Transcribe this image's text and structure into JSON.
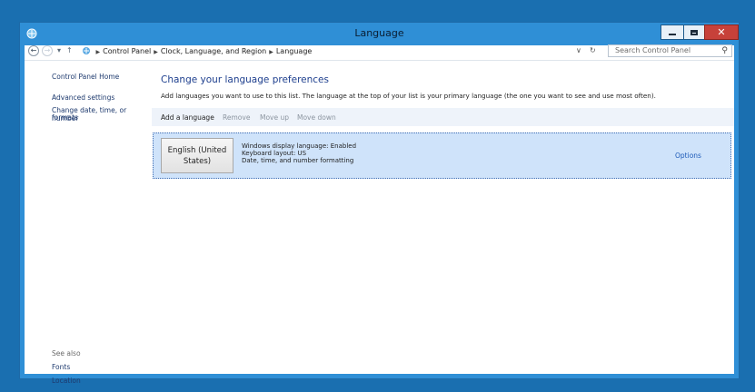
{
  "window": {
    "title": "Language"
  },
  "address": {
    "crumbs": [
      "Control Panel",
      "Clock, Language, and Region",
      "Language"
    ],
    "search_placeholder": "Search Control Panel"
  },
  "left_pane": {
    "home": "Control Panel Home",
    "advanced": "Advanced settings",
    "change_formats_line1": "Change date, time, or number",
    "change_formats_line2": "formats",
    "see_also": "See also",
    "fonts": "Fonts",
    "location": "Location"
  },
  "main": {
    "heading": "Change your language preferences",
    "description": "Add languages you want to use to this list. The language at the top of your list is your primary language (the one you want to see and use most often).",
    "toolbar": {
      "add": "Add a language",
      "remove": "Remove",
      "move_up": "Move up",
      "move_down": "Move down"
    },
    "languages": [
      {
        "name_line1": "English (United",
        "name_line2": "States)",
        "details": [
          "Windows display language: Enabled",
          "Keyboard layout: US",
          "Date, time, and number formatting"
        ],
        "options": "Options"
      }
    ]
  },
  "colors": {
    "desktop": "#1a6fb0",
    "window_frame": "#2f8fd6",
    "close_button": "#c7413a",
    "selected_row": "#cfe3fa",
    "link": "#1e3a6e"
  }
}
